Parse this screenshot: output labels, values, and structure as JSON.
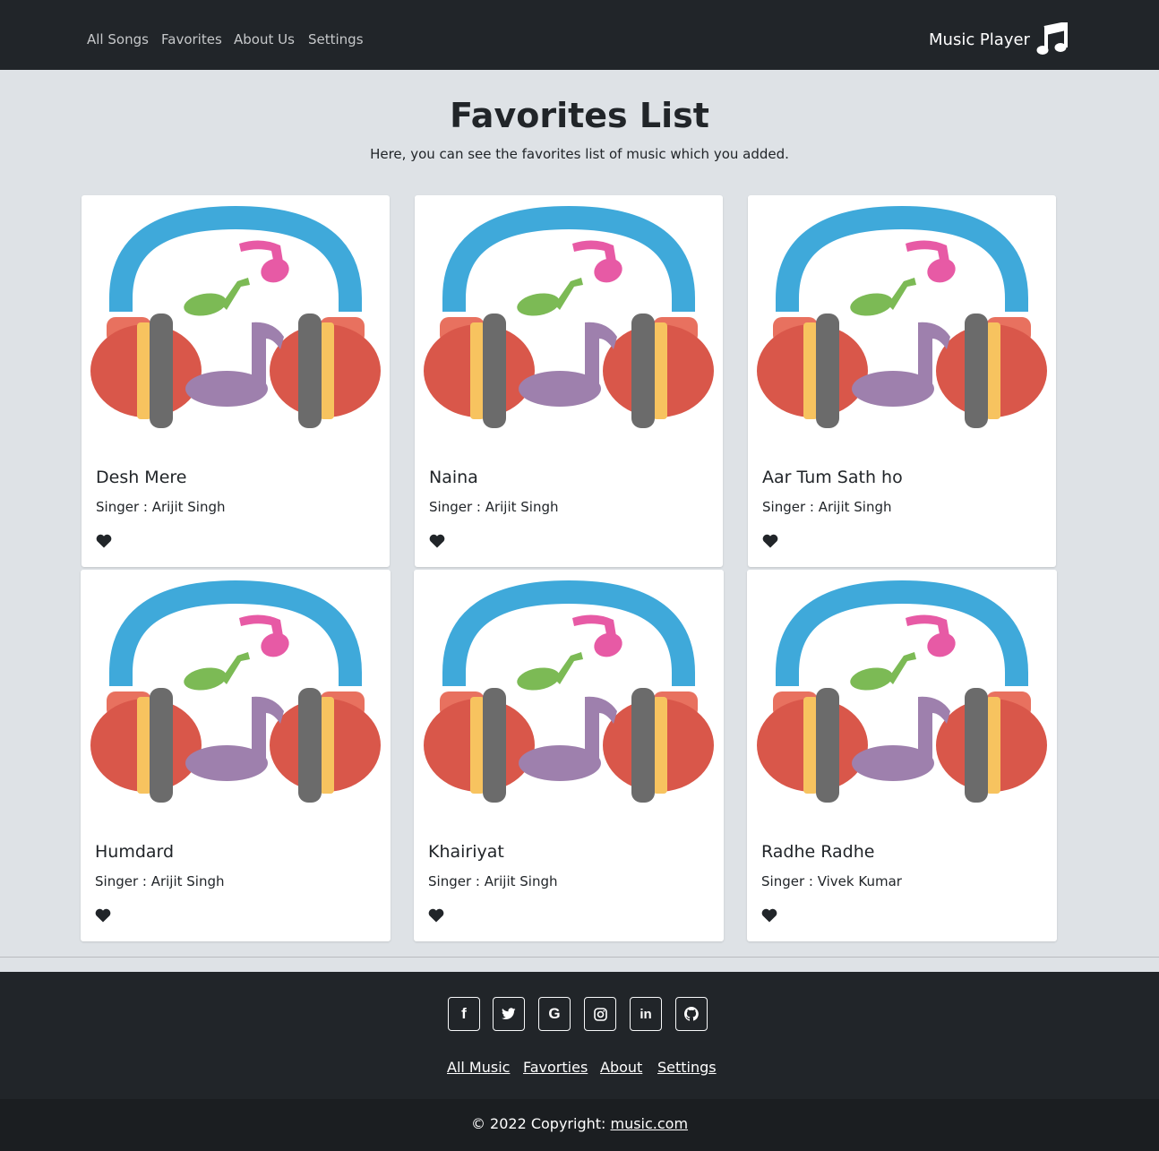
{
  "nav": {
    "links": [
      "All Songs",
      "Favorites",
      "About Us",
      "Settings"
    ],
    "brand": "Music Player",
    "brand_icon": "music-note-icon"
  },
  "header": {
    "title": "Favorites List",
    "subtitle": "Here, you can see the favorites list of music which you added."
  },
  "songs": [
    {
      "title": "Desh Mere",
      "singer": "Singer : Arijit Singh"
    },
    {
      "title": "Naina",
      "singer": "Singer : Arijit Singh"
    },
    {
      "title": "Aar Tum Sath ho",
      "singer": "Singer : Arijit Singh"
    },
    {
      "title": "Humdard",
      "singer": "Singer : Arijit Singh"
    },
    {
      "title": "Khairiyat",
      "singer": "Singer : Arijit Singh"
    },
    {
      "title": "Radhe Radhe",
      "singer": "Singer : Vivek Kumar"
    }
  ],
  "footer": {
    "social": [
      {
        "icon": "facebook-icon",
        "glyph": "f"
      },
      {
        "icon": "twitter-icon",
        "glyph": ""
      },
      {
        "icon": "google-icon",
        "glyph": "G"
      },
      {
        "icon": "instagram-icon",
        "glyph": ""
      },
      {
        "icon": "linkedin-icon",
        "glyph": "in"
      },
      {
        "icon": "github-icon",
        "glyph": ""
      }
    ],
    "links": [
      "All Music",
      "Favorties",
      "About",
      "Settings"
    ],
    "copyright": "© 2022 Copyright: ",
    "copyright_link": "music.com"
  },
  "colors": {
    "navbar": "#212529",
    "background": "#dee2e6",
    "headband": "#3fa9da",
    "earcup": "#d9574a",
    "note_pink": "#e75aa5",
    "note_green": "#7cba55",
    "note_purple": "#9e80ad"
  }
}
